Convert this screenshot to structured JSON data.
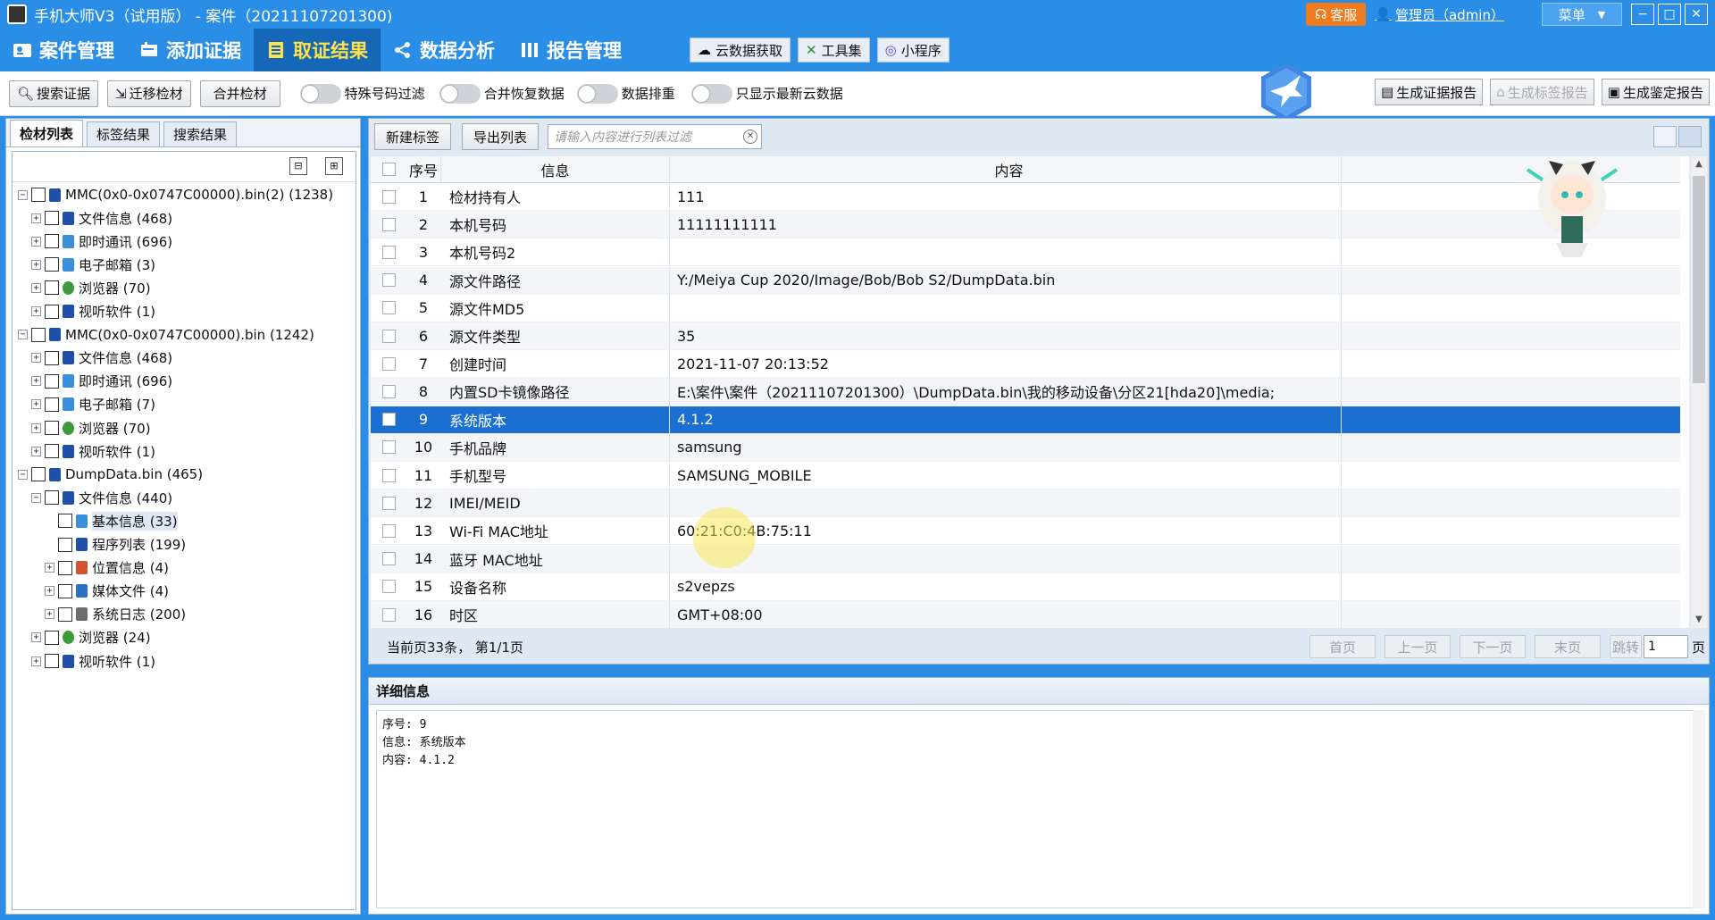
{
  "window": {
    "title": "手机大师V3（试用版）  - 案件（20211107201300)",
    "kefu": "客服",
    "admin": "管理员（admin）",
    "menu": "菜单"
  },
  "nav": {
    "items": [
      {
        "label": "案件管理",
        "icon": "user-card-icon"
      },
      {
        "label": "添加证据",
        "icon": "add-evidence-icon"
      },
      {
        "label": "取证结果",
        "icon": "document-list-icon",
        "active": true
      },
      {
        "label": "数据分析",
        "icon": "share-nodes-icon"
      },
      {
        "label": "报告管理",
        "icon": "bars-icon"
      }
    ],
    "tools": [
      {
        "label": "云数据获取",
        "icon": "cloud-icon"
      },
      {
        "label": "工具集",
        "icon": "tools-icon"
      },
      {
        "label": "小程序",
        "icon": "miniapp-icon"
      }
    ]
  },
  "toolbar": {
    "buttons": [
      "搜索证据",
      "迁移检材",
      "合并检材"
    ],
    "toggles": [
      "特殊号码过滤",
      "合并恢复数据",
      "数据排重",
      "只显示最新云数据"
    ],
    "report_buttons": [
      {
        "label": "生成证据报告",
        "disabled": false
      },
      {
        "label": "生成标签报告",
        "disabled": true
      },
      {
        "label": "生成鉴定报告",
        "disabled": false
      }
    ]
  },
  "left": {
    "tabs": [
      "检材列表",
      "标签结果",
      "搜索结果"
    ],
    "tree": [
      {
        "label": "MMC(0x0-0x0747C00000).bin(2) (1238)",
        "level": 0,
        "exp": "−",
        "icon": "phone-icon"
      },
      {
        "label": "文件信息 (468)",
        "level": 1,
        "exp": "+",
        "icon": "phone-file-icon"
      },
      {
        "label": "即时通讯 (696)",
        "level": 1,
        "exp": "+",
        "icon": "chat-icon"
      },
      {
        "label": "电子邮箱 (3)",
        "level": 1,
        "exp": "+",
        "icon": "email-icon"
      },
      {
        "label": "浏览器 (70)",
        "level": 1,
        "exp": "+",
        "icon": "globe-icon"
      },
      {
        "label": "视听软件 (1)",
        "level": 1,
        "exp": "+",
        "icon": "media-icon"
      },
      {
        "label": "MMC(0x0-0x0747C00000).bin (1242)",
        "level": 0,
        "exp": "−",
        "icon": "phone-icon"
      },
      {
        "label": "文件信息 (468)",
        "level": 1,
        "exp": "+",
        "icon": "phone-file-icon"
      },
      {
        "label": "即时通讯 (696)",
        "level": 1,
        "exp": "+",
        "icon": "chat-icon"
      },
      {
        "label": "电子邮箱 (7)",
        "level": 1,
        "exp": "+",
        "icon": "email-icon"
      },
      {
        "label": "浏览器 (70)",
        "level": 1,
        "exp": "+",
        "icon": "globe-icon"
      },
      {
        "label": "视听软件 (1)",
        "level": 1,
        "exp": "+",
        "icon": "media-icon"
      },
      {
        "label": "DumpData.bin (465)",
        "level": 0,
        "exp": "−",
        "icon": "phone-icon"
      },
      {
        "label": "文件信息 (440)",
        "level": 1,
        "exp": "−",
        "icon": "phone-file-icon"
      },
      {
        "label": "基本信息 (33)",
        "level": 2,
        "exp": "",
        "icon": "info-icon",
        "selected": true
      },
      {
        "label": "程序列表 (199)",
        "level": 2,
        "exp": "",
        "icon": "app-list-icon"
      },
      {
        "label": "位置信息 (4)",
        "level": 2,
        "exp": "+",
        "icon": "location-icon"
      },
      {
        "label": "媒体文件 (4)",
        "level": 2,
        "exp": "+",
        "icon": "film-icon"
      },
      {
        "label": "系统日志 (200)",
        "level": 2,
        "exp": "+",
        "icon": "log-icon"
      },
      {
        "label": "浏览器 (24)",
        "level": 1,
        "exp": "+",
        "icon": "globe-icon"
      },
      {
        "label": "视听软件 (1)",
        "level": 1,
        "exp": "+",
        "icon": "media-icon"
      }
    ]
  },
  "list": {
    "new_tag": "新建标签",
    "export": "导出列表",
    "filter_placeholder": "请输入内容进行列表过滤",
    "columns": [
      "序号",
      "信息",
      "内容"
    ],
    "rows": [
      {
        "no": "1",
        "info": "检材持有人",
        "content": "111"
      },
      {
        "no": "2",
        "info": "本机号码",
        "content": "11111111111"
      },
      {
        "no": "3",
        "info": "本机号码2",
        "content": ""
      },
      {
        "no": "4",
        "info": "源文件路径",
        "content": "Y:/Meiya Cup 2020/Image/Bob/Bob S2/DumpData.bin"
      },
      {
        "no": "5",
        "info": "源文件MD5",
        "content": ""
      },
      {
        "no": "6",
        "info": "源文件类型",
        "content": "35"
      },
      {
        "no": "7",
        "info": "创建时间",
        "content": "2021-11-07 20:13:52"
      },
      {
        "no": "8",
        "info": "内置SD卡镜像路径",
        "content": "E:\\案件\\案件（20211107201300）\\DumpData.bin\\我的移动设备\\分区21[hda20]\\media;"
      },
      {
        "no": "9",
        "info": "系统版本",
        "content": "4.1.2",
        "selected": true
      },
      {
        "no": "10",
        "info": "手机品牌",
        "content": "samsung"
      },
      {
        "no": "11",
        "info": "手机型号",
        "content": "SAMSUNG_MOBILE"
      },
      {
        "no": "12",
        "info": "IMEI/MEID",
        "content": ""
      },
      {
        "no": "13",
        "info": "Wi-Fi MAC地址",
        "content": "60:21:C0:4B:75:11"
      },
      {
        "no": "14",
        "info": "蓝牙 MAC地址",
        "content": ""
      },
      {
        "no": "15",
        "info": "设备名称",
        "content": "s2vepzs"
      },
      {
        "no": "16",
        "info": "时区",
        "content": "GMT+08:00"
      }
    ],
    "pager": {
      "info": "当前页33条，  第1/1页",
      "first": "首页",
      "prev": "上一页",
      "next": "下一页",
      "last": "末页",
      "jump": "跳转",
      "page_value": "1",
      "unit": "页"
    }
  },
  "detail": {
    "title": "详细信息",
    "lines": [
      "序号: 9",
      "信息: 系统版本",
      "内容: 4.1.2"
    ]
  },
  "colors": {
    "accent": "#2a8ee6",
    "active_nav": "#1568b8",
    "selected_row": "#1a6fd0",
    "kefu": "#f07c1e"
  }
}
